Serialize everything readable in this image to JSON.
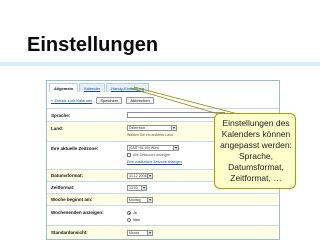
{
  "slide": {
    "title": "Einstellungen",
    "callout_text": "Einstellungen des Kalenders können angepasst werden: Sprache, Datumsformat, Zeitformat, …"
  },
  "settings": {
    "tabs": [
      {
        "label": "Allgemein"
      },
      {
        "label": "Kalender"
      },
      {
        "label": "Handy-Einrichtung"
      }
    ],
    "back_link": "« Zurück zum Kalender",
    "save_label": "Speichern",
    "cancel_label": "Abbrechen",
    "language": {
      "label": "Sprache:",
      "value": ""
    },
    "country": {
      "label": "Land:",
      "value": "Österreich",
      "hint": "Wählen Sie ein anderes Land"
    },
    "timezone": {
      "label": "Ihre aktuelle Zeitzone:",
      "value": "(GMT+01:00) Wien",
      "checkbox_label": "Alle Zeitzonen anzeigen",
      "extra_link": "Eine zusätzliche Zeitzone anzeigen"
    },
    "date_format": {
      "label": "Datumsformat:",
      "value": "31.12.2008"
    },
    "time_format": {
      "label": "Zeitformat:",
      "value": "13:00"
    },
    "week_start": {
      "label": "Woche beginnt am:",
      "value": "Montag"
    },
    "weekends": {
      "label": "Wochenenden anzeigen:",
      "options": [
        "Ja",
        "Nein"
      ],
      "selected": "Ja"
    },
    "default_view": {
      "label": "Standardansicht:",
      "value": "Monat"
    }
  }
}
